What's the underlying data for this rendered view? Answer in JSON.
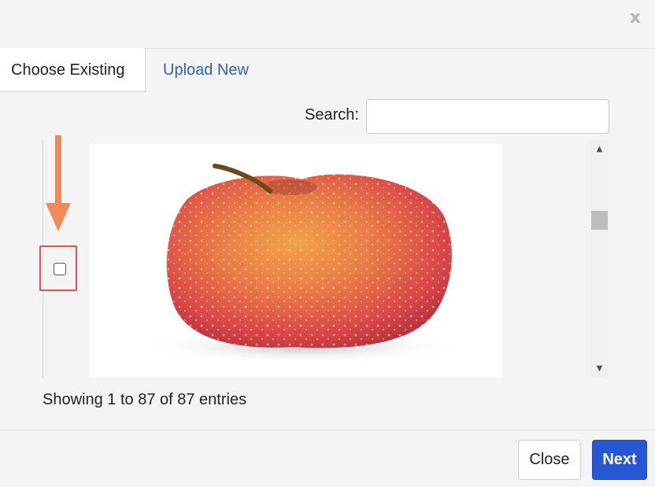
{
  "dialog": {
    "close_glyph": "x"
  },
  "tabs": [
    {
      "label": "Choose Existing",
      "active": true
    },
    {
      "label": "Upload New",
      "active": false
    }
  ],
  "search": {
    "label": "Search:",
    "value": ""
  },
  "list": {
    "rows": [
      {
        "checked": false,
        "image": "red-apple-photo"
      }
    ],
    "annotation": {
      "arrow_color": "#f08a5d",
      "highlight_color": "#e0524c"
    }
  },
  "info": {
    "entries_text": "Showing 1 to 87 of 87 entries"
  },
  "footer": {
    "close_label": "Close",
    "next_label": "Next"
  },
  "colors": {
    "accent": "#2857d6",
    "link": "#2b62c7"
  }
}
